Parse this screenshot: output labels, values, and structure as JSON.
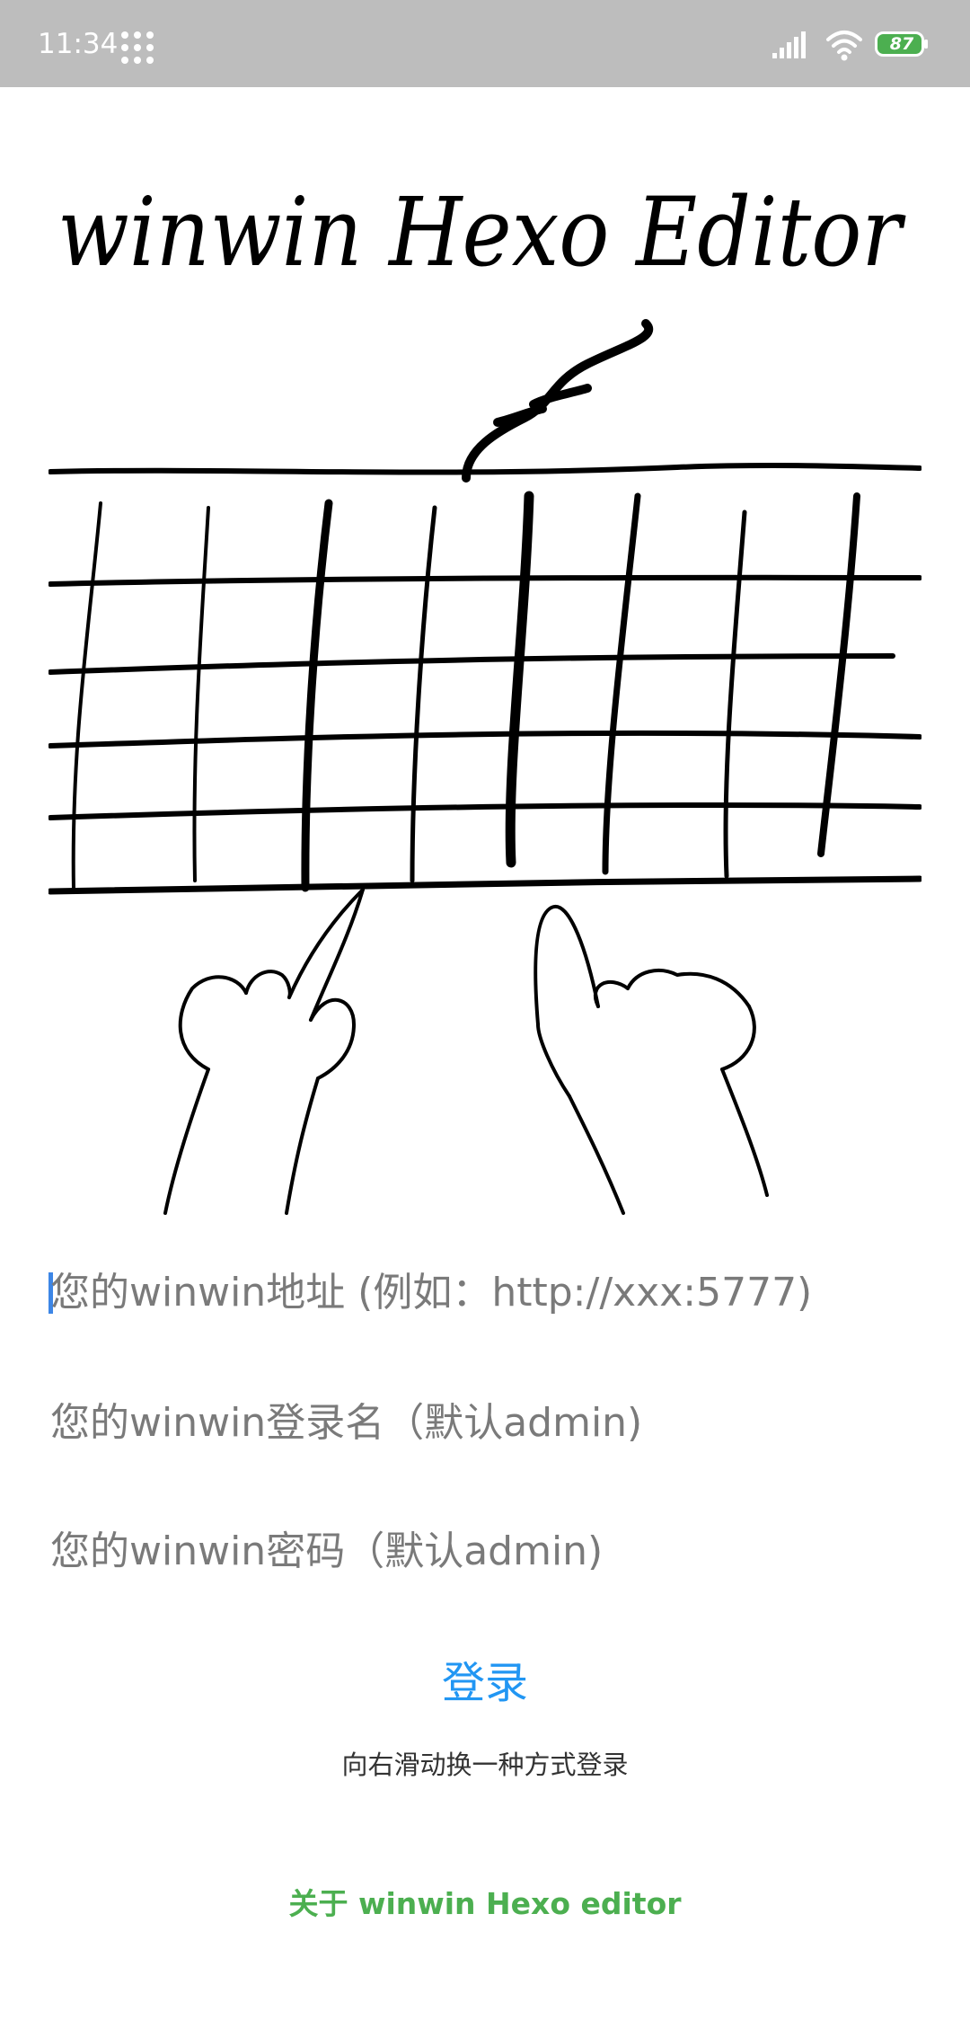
{
  "status_bar": {
    "time": "11:34",
    "battery_level": "87",
    "icons": [
      "apps-grid-icon",
      "signal-icon",
      "wifi-icon",
      "battery-icon"
    ]
  },
  "hero": {
    "heading": "winwin Hexo Editor"
  },
  "form": {
    "url_placeholder": "您的winwin地址 (例如：http://xxx:5777)",
    "user_placeholder": "您的winwin登录名（默认admin)",
    "password_placeholder": "您的winwin密码（默认admin)",
    "login_label": "登录"
  },
  "swipe_hint": "向右滑动换一种方式登录",
  "about_label": "关于 winwin Hexo editor",
  "colors": {
    "status_bar": "#bdbdbd",
    "login": "#2196f3",
    "about": "#4caf50",
    "battery": "#4caf50"
  }
}
